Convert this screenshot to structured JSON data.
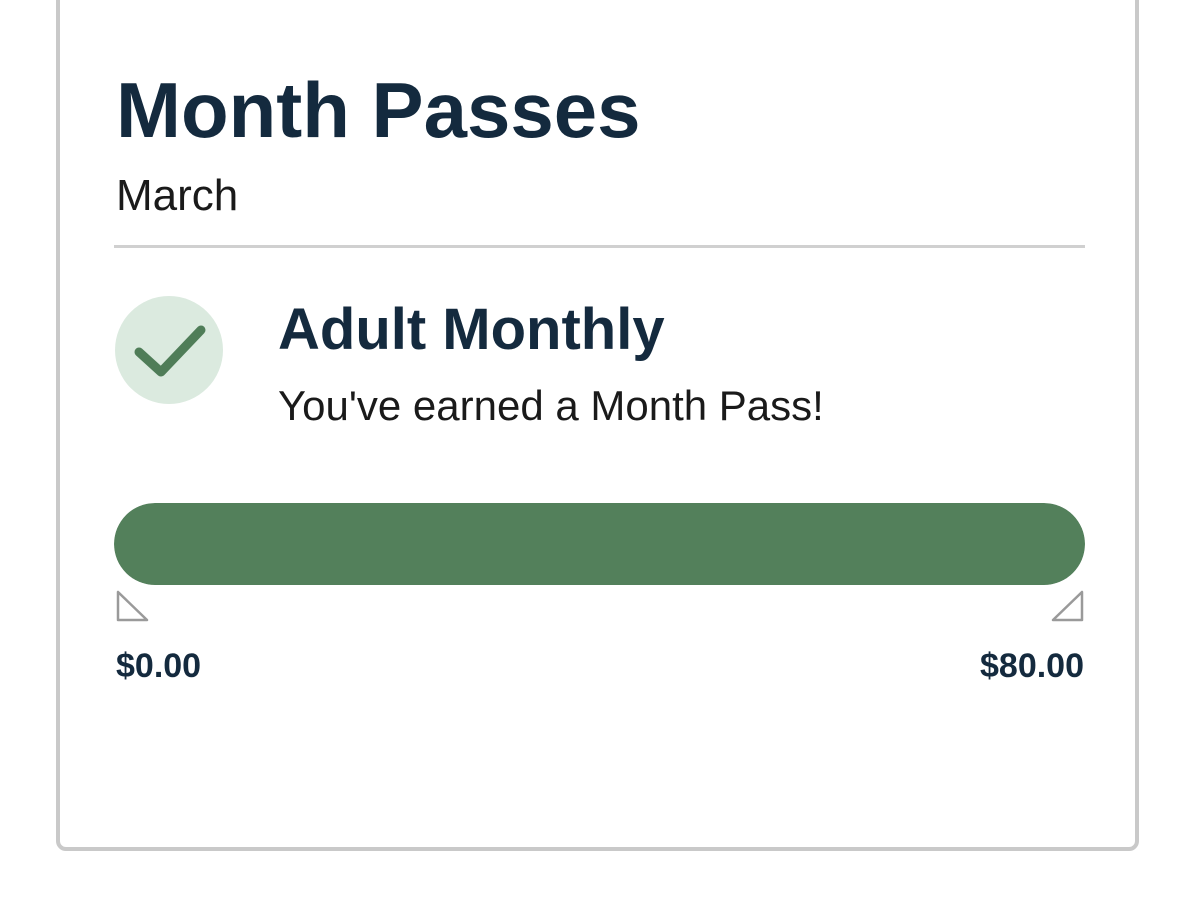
{
  "card": {
    "title": "Month Passes",
    "month": "March"
  },
  "pass": {
    "icon": "check-icon",
    "name": "Adult Monthly",
    "status_message": "You've earned a Month Pass!"
  },
  "progress": {
    "fraction": 1.0,
    "min_label": "$0.00",
    "max_label": "$80.00"
  },
  "colors": {
    "title_text": "#142a3e",
    "progress_fill": "#53805b",
    "check_circle_bg": "#dbeadf",
    "check_mark": "#4f7d58",
    "divider": "#d0d0d0",
    "card_border": "#c9c9c9"
  }
}
